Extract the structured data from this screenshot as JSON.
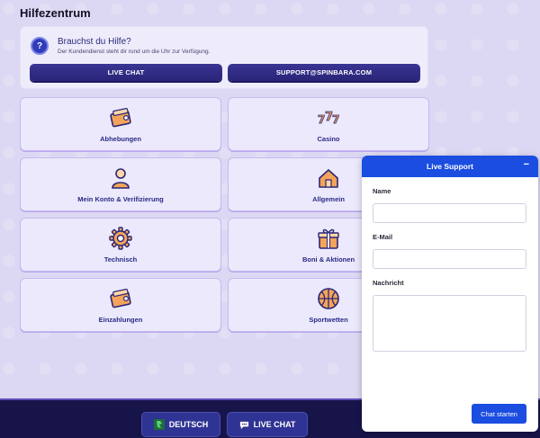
{
  "page": {
    "title": "Hilfezentrum"
  },
  "help": {
    "title": "Brauchst du Hilfe?",
    "subtitle": "Der Kundendienst steht dir rund um die Uhr zur Verfügung.",
    "icon": "question-icon",
    "live_chat_label": "LIVE CHAT",
    "email_label": "SUPPORT@SPINBARA.COM"
  },
  "categories": [
    {
      "label": "Abhebungen",
      "icon": "wallet-icon"
    },
    {
      "label": "Casino",
      "icon": "slot-777-icon"
    },
    {
      "label": "Mein Konto & Verifizierung",
      "icon": "user-icon"
    },
    {
      "label": "Allgemein",
      "icon": "house-icon"
    },
    {
      "label": "Technisch",
      "icon": "gear-icon"
    },
    {
      "label": "Boni & Aktionen",
      "icon": "gift-icon"
    },
    {
      "label": "Einzahlungen",
      "icon": "wallet-icon"
    },
    {
      "label": "Sportwetten",
      "icon": "basketball-icon"
    }
  ],
  "footer": {
    "language_label": "DEUTSCH",
    "live_chat_label": "LIVE CHAT"
  },
  "support_panel": {
    "title": "Live Support",
    "minimize_symbol": "−",
    "name_label": "Name",
    "email_label": "E-Mail",
    "message_label": "Nachricht",
    "submit_label": "Chat starten"
  },
  "colors": {
    "accent_blue": "#1b4de0",
    "dark_purple": "#2a2578",
    "background": "#dcd8f3",
    "footer_bg": "#17144a"
  }
}
